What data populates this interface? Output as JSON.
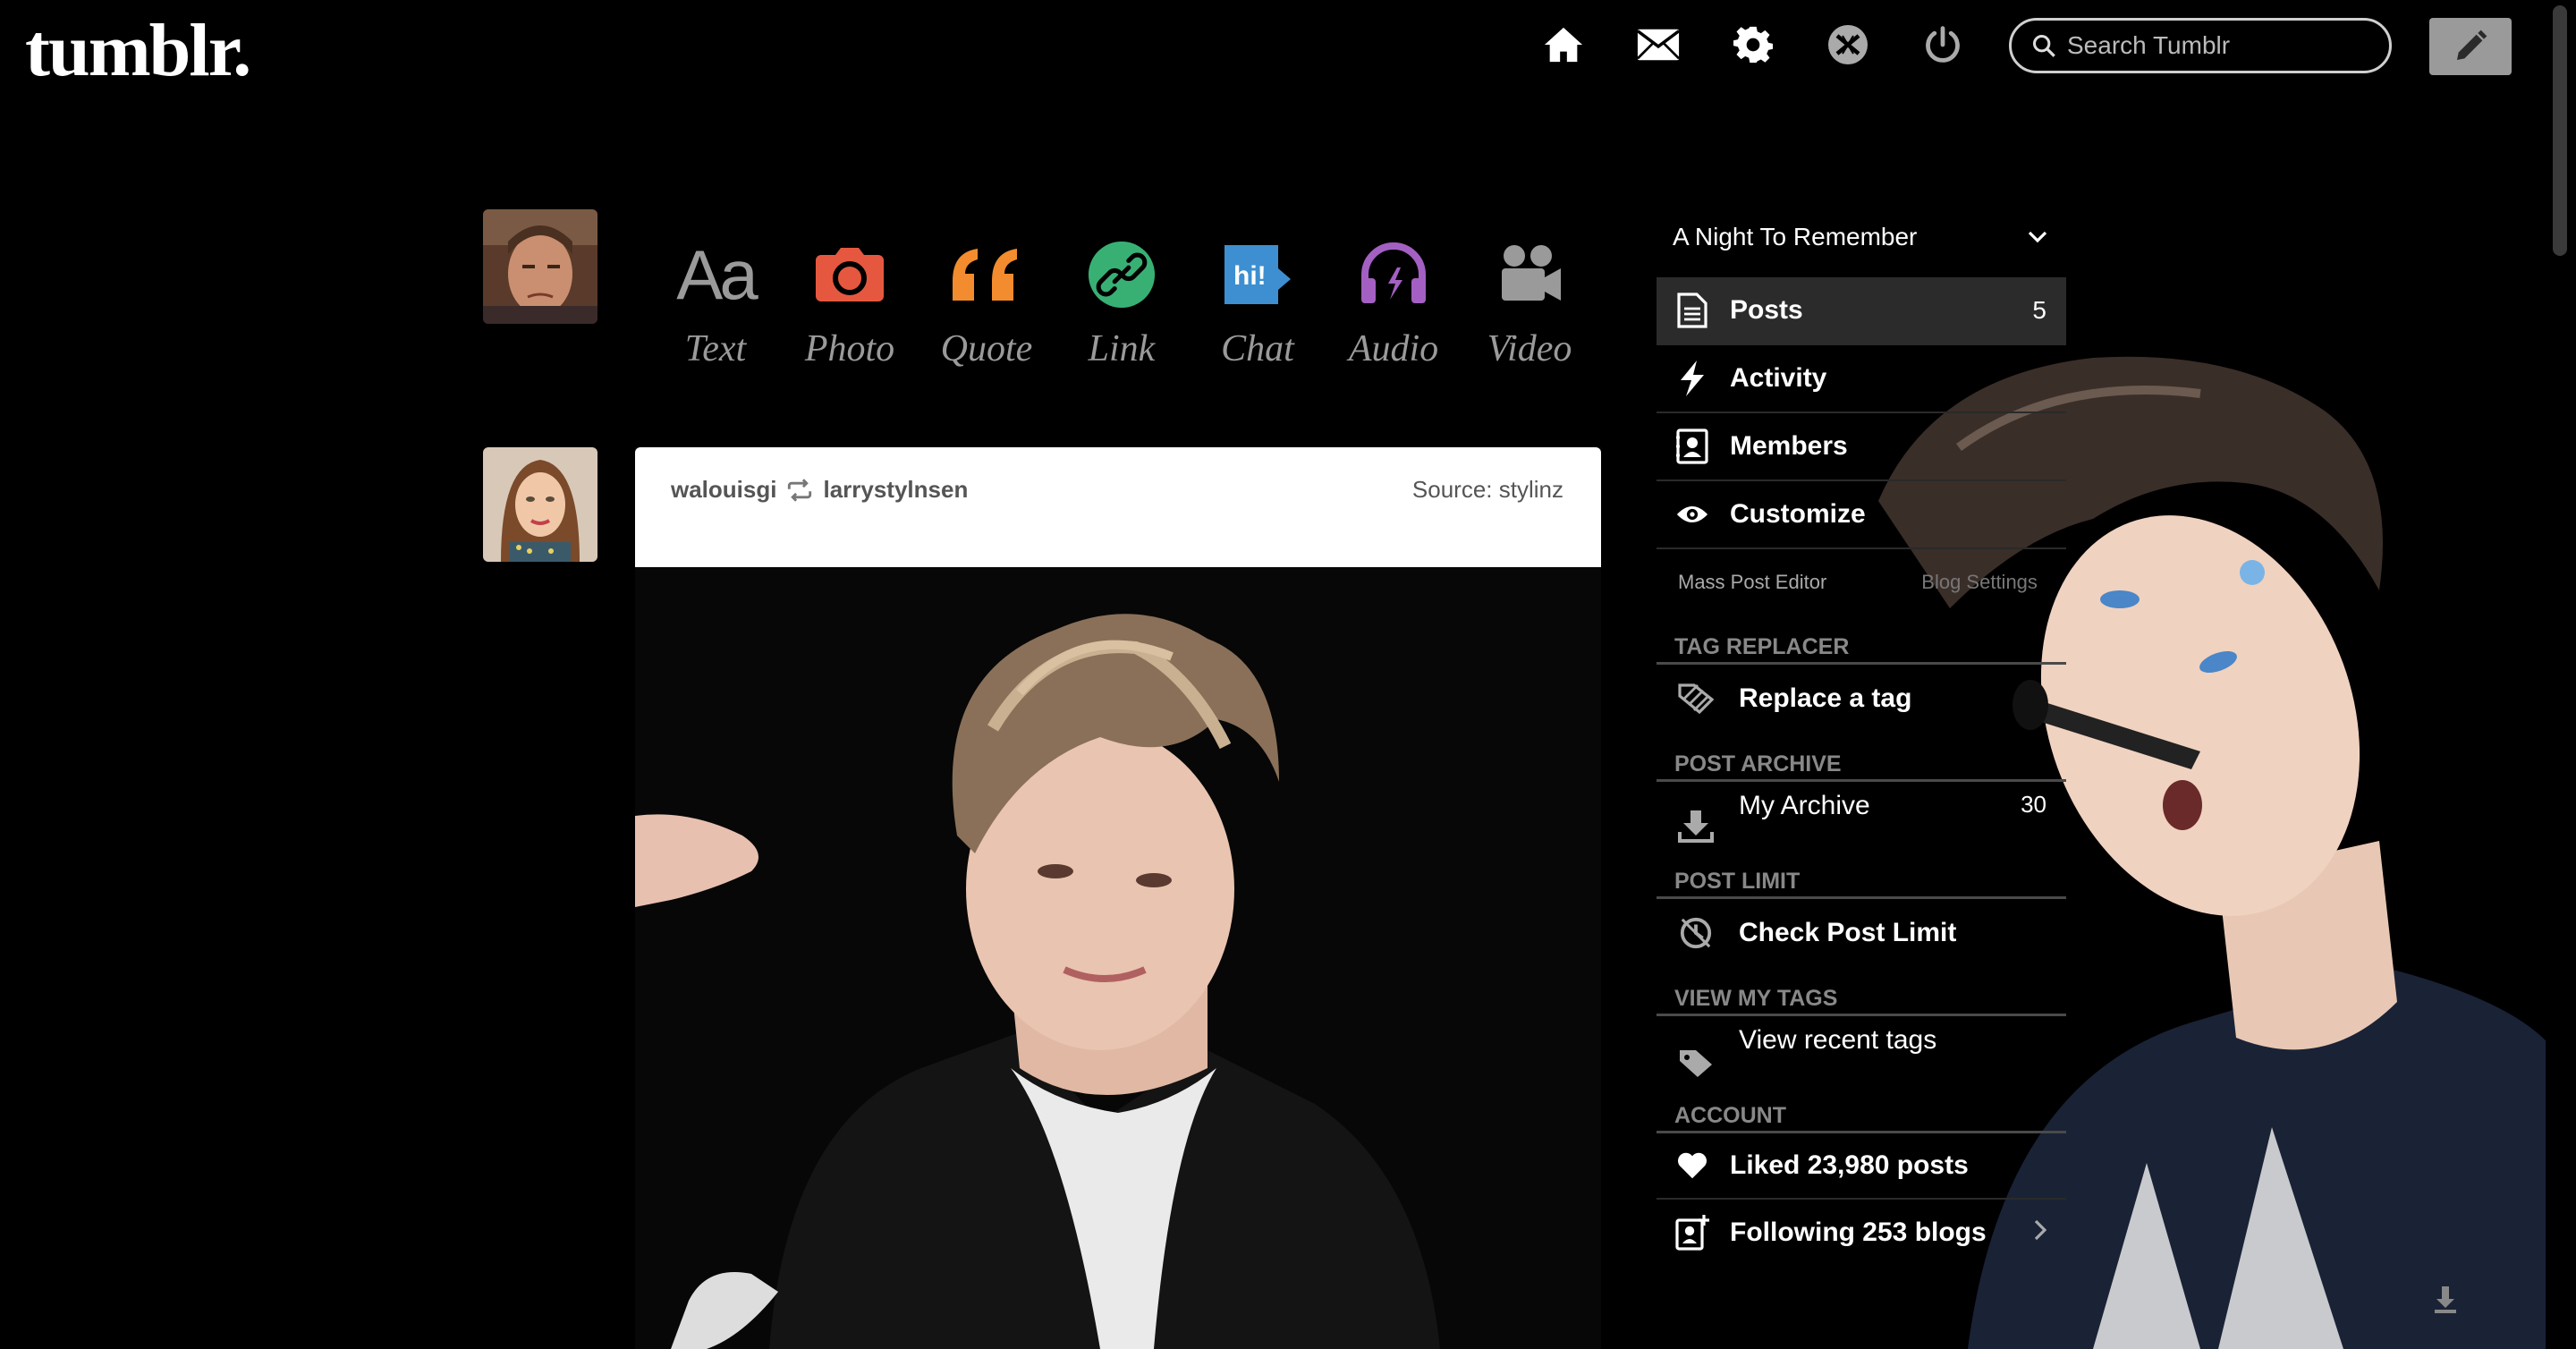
{
  "header": {
    "logo": "tumblr.",
    "search_placeholder": "Search Tumblr",
    "icons": [
      "home-icon",
      "mail-icon",
      "gear-icon",
      "xkit-icon",
      "power-icon"
    ]
  },
  "post_types": [
    {
      "label": "Text",
      "icon": "text-icon",
      "color": "#9a9a9a"
    },
    {
      "label": "Photo",
      "icon": "camera-icon",
      "color": "#e5583f"
    },
    {
      "label": "Quote",
      "icon": "quote-icon",
      "color": "#f28c2e"
    },
    {
      "label": "Link",
      "icon": "link-icon",
      "color": "#38b074"
    },
    {
      "label": "Chat",
      "icon": "chat-icon",
      "color": "#3d8fd1"
    },
    {
      "label": "Audio",
      "icon": "headphones-icon",
      "color": "#a360c2"
    },
    {
      "label": "Video",
      "icon": "video-camera-icon",
      "color": "#9a9a9a"
    }
  ],
  "post": {
    "author": "walouisgi",
    "reblogged_from": "larrystylnsen",
    "source_label": "Source:",
    "source": "stylinz"
  },
  "sidebar": {
    "blog_name": "A Night To Remember",
    "items": [
      {
        "label": "Posts",
        "icon": "posts-icon",
        "count": "5",
        "active": true
      },
      {
        "label": "Activity",
        "icon": "lightning-icon",
        "count": ""
      },
      {
        "label": "Members",
        "icon": "members-icon",
        "count": ""
      },
      {
        "label": "Customize",
        "icon": "eye-icon",
        "count": ""
      }
    ],
    "sub_links": [
      "Mass Post Editor",
      "Blog Settings"
    ],
    "sections": [
      {
        "heading": "TAG REPLACER",
        "item": "Replace a tag",
        "icon": "tag-replace-icon",
        "bold": true,
        "count": ""
      },
      {
        "heading": "POST ARCHIVE",
        "item": "My Archive",
        "icon": "download-icon",
        "bold": false,
        "count": "30"
      },
      {
        "heading": "POST LIMIT",
        "item": "Check Post Limit",
        "icon": "clock-icon",
        "bold": true,
        "count": ""
      },
      {
        "heading": "VIEW MY TAGS",
        "item": "View recent tags",
        "icon": "tag-icon",
        "bold": false,
        "count": ""
      }
    ],
    "account_heading": "ACCOUNT",
    "account_items": [
      {
        "label": "Liked 23,980 posts",
        "icon": "heart-icon"
      },
      {
        "label": "Following 253 blogs",
        "icon": "following-icon"
      }
    ]
  }
}
